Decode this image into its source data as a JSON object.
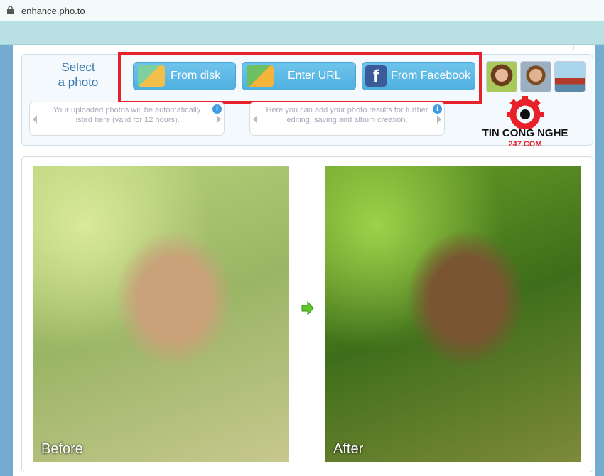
{
  "browser": {
    "url": "enhance.pho.to"
  },
  "select": {
    "label_line1": "Select",
    "label_line2": "a photo"
  },
  "buttons": [
    {
      "label": "From disk",
      "icon": "folder-photo-icon"
    },
    {
      "label": "Enter URL",
      "icon": "http-url-icon"
    },
    {
      "label": "From Facebook",
      "icon": "facebook-icon"
    }
  ],
  "samples": [
    {
      "icon": "woman-portrait"
    },
    {
      "icon": "man-portrait"
    },
    {
      "icon": "boat-photo"
    }
  ],
  "info": {
    "uploaded": "Your uploaded photos will be automatically listed here (valid for 12 hours).",
    "results": "Here you can add your photo results for further editing, saving and album creation.",
    "info_glyph": "i"
  },
  "watermark": {
    "line1": "TIN CONG NGHE",
    "line2": "247.COM"
  },
  "preview": {
    "before": "Before",
    "after": "After"
  },
  "colors": {
    "highlight": "#e8202a",
    "button": "#5bb8e6",
    "accent": "#3a78ae"
  }
}
